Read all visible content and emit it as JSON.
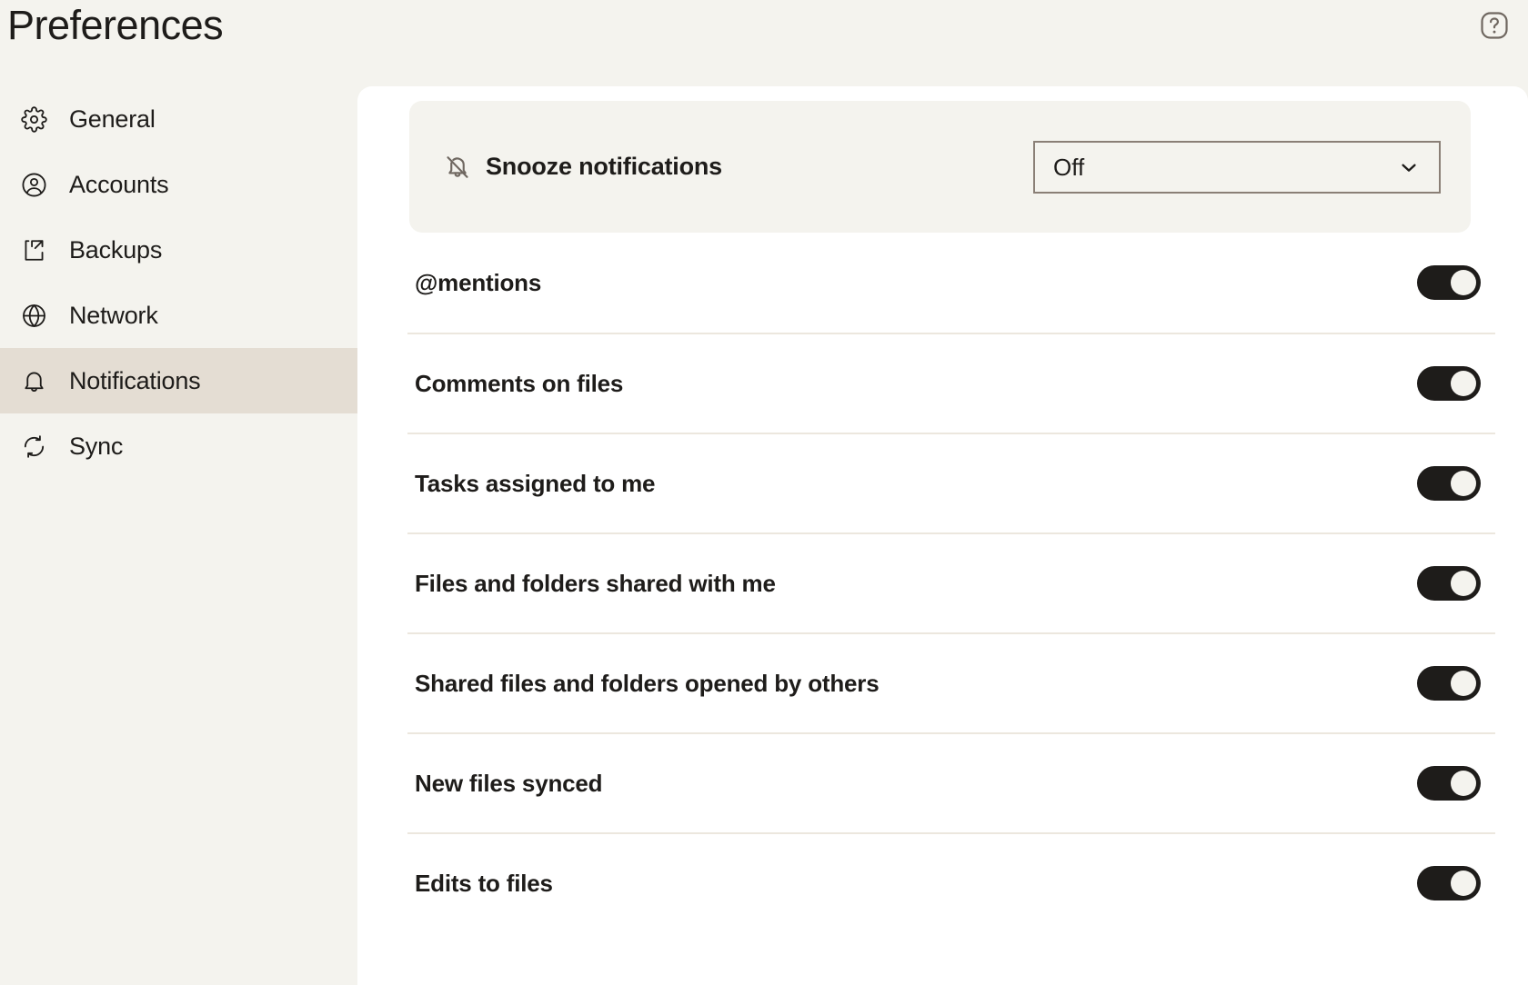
{
  "header": {
    "title": "Preferences",
    "help_icon": "help-circle-icon"
  },
  "sidebar": {
    "items": [
      {
        "label": "General",
        "icon": "gear-icon",
        "active": false
      },
      {
        "label": "Accounts",
        "icon": "user-circle-icon",
        "active": false
      },
      {
        "label": "Backups",
        "icon": "backup-export-icon",
        "active": false
      },
      {
        "label": "Network",
        "icon": "globe-icon",
        "active": false
      },
      {
        "label": "Notifications",
        "icon": "bell-icon",
        "active": true
      },
      {
        "label": "Sync",
        "icon": "sync-icon",
        "active": false
      }
    ]
  },
  "main": {
    "snooze": {
      "icon": "bell-off-icon",
      "label": "Snooze notifications",
      "select_value": "Off",
      "select_chevron": "chevron-down-icon",
      "options": [
        "Off"
      ]
    },
    "toggles": [
      {
        "label": "@mentions",
        "state": "on"
      },
      {
        "label": "Comments on files",
        "state": "on"
      },
      {
        "label": "Tasks assigned to me",
        "state": "on"
      },
      {
        "label": "Files and folders shared with me",
        "state": "on"
      },
      {
        "label": "Shared files and folders opened by others",
        "state": "on"
      },
      {
        "label": "New files synced",
        "state": "on"
      },
      {
        "label": "Edits to files",
        "state": "on"
      }
    ]
  },
  "colors": {
    "app_background": "#f4f3ee",
    "card_background": "#ffffff",
    "sidebar_active": "#e4ddd3",
    "text_primary": "#1e1c1a",
    "muted": "#8a7f76",
    "divider": "#ece7de",
    "toggle_on": "#1e1c1a"
  }
}
